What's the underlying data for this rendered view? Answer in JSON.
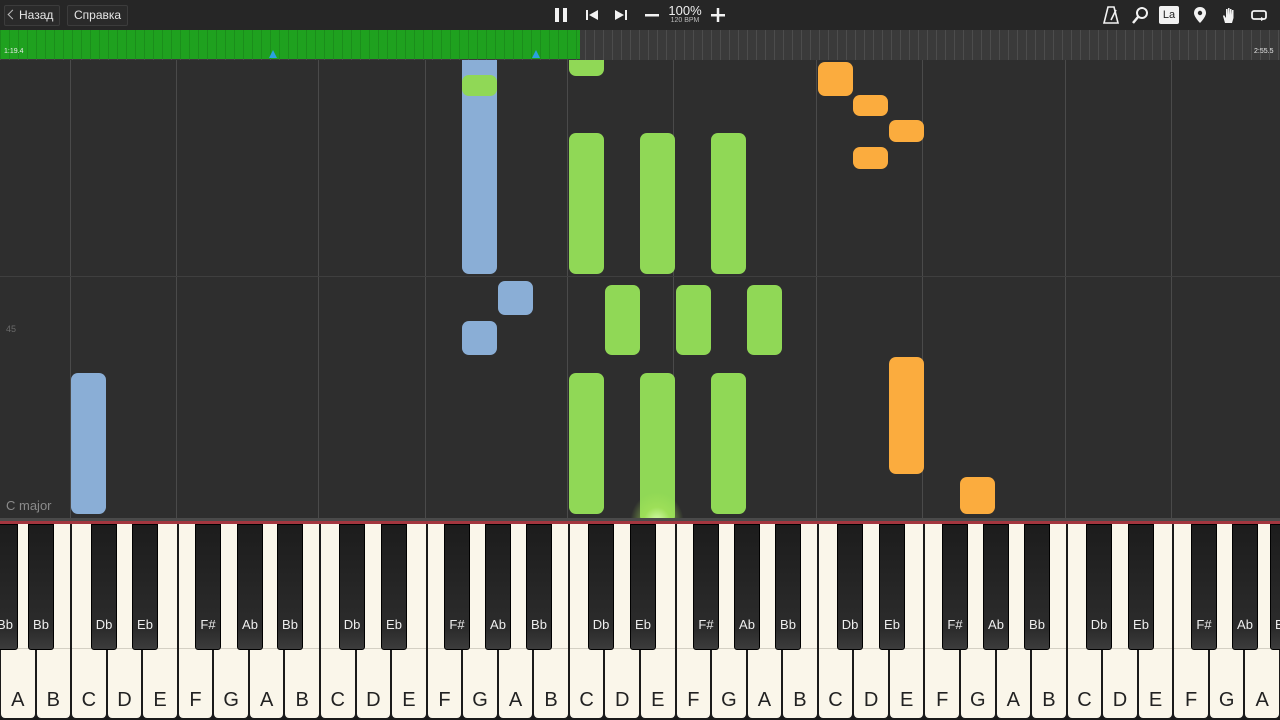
{
  "toolbar": {
    "back_label": "Назад",
    "help_label": "Справка",
    "zoom": "100%",
    "tempo": "120 BPM",
    "icons": [
      "pause-icon",
      "skip-back-icon",
      "skip-forward-icon",
      "minus-icon",
      "plus-icon",
      "metronome-icon",
      "magnifier-icon",
      "label-la-icon",
      "location-pin-icon",
      "hand-icon",
      "loop-icon"
    ],
    "la_text": "La"
  },
  "timeline": {
    "current_time": "1:19.4",
    "total_time": "2:55.5",
    "progress": 0.453,
    "marker_positions": [
      0.213,
      0.418
    ],
    "fill_color": "#1fa11f"
  },
  "roll": {
    "pitch_label": "45",
    "key_signature": "C major",
    "colors": {
      "blue": "#8aaed6",
      "green": "#90d856",
      "orange": "#fbac3e"
    }
  },
  "keyboard": {
    "white_keys": [
      "A",
      "B",
      "C",
      "D",
      "E",
      "F",
      "G",
      "A",
      "B",
      "C",
      "D",
      "E",
      "F",
      "G",
      "A",
      "B",
      "C",
      "D",
      "E",
      "F",
      "G",
      "A",
      "B",
      "C",
      "D",
      "E",
      "F",
      "G",
      "A",
      "B",
      "C",
      "D",
      "E",
      "F",
      "G",
      "A"
    ],
    "black_keys": [
      "Bb",
      "Bb",
      "Db",
      "Eb",
      "F#",
      "Ab",
      "Bb",
      "Db",
      "Eb",
      "F#",
      "Ab",
      "Bb",
      "Db",
      "Eb",
      "F#",
      "Ab",
      "Bb",
      "Db",
      "Eb",
      "F#",
      "Ab",
      "Bb",
      "Db",
      "Eb",
      "F#",
      "Ab",
      "Bb"
    ]
  }
}
